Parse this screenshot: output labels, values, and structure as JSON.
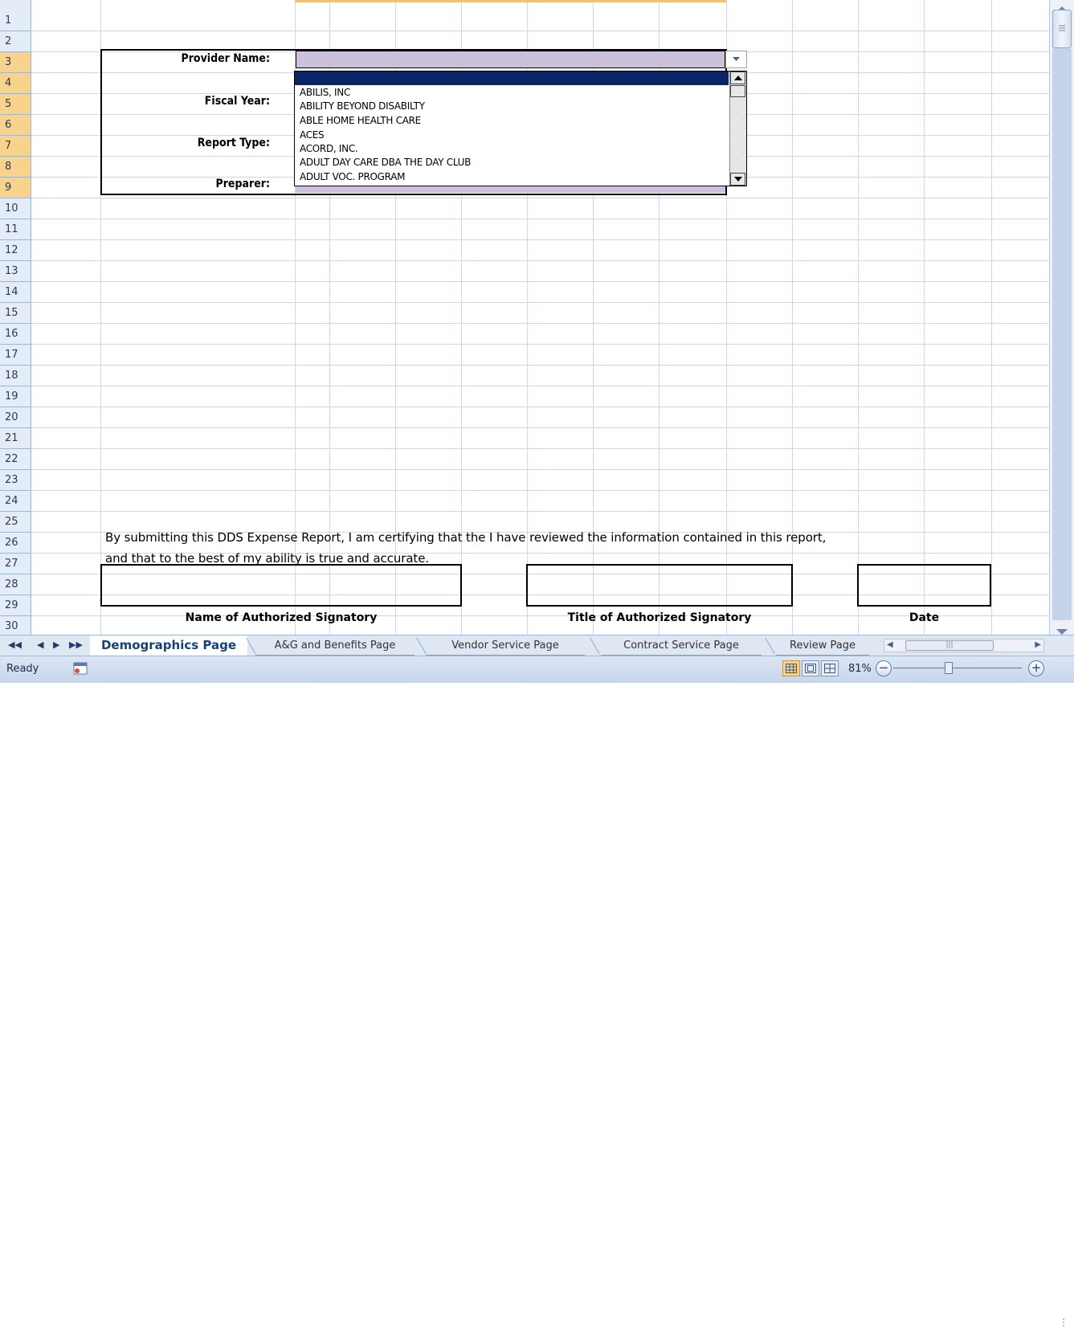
{
  "rows": [
    "1",
    "2",
    "3",
    "4",
    "5",
    "6",
    "7",
    "8",
    "9",
    "10",
    "11",
    "12",
    "13",
    "14",
    "15",
    "16",
    "17",
    "18",
    "19",
    "20",
    "21",
    "22",
    "23",
    "24",
    "25",
    "26",
    "27",
    "28",
    "29",
    "30"
  ],
  "form": {
    "provider_label": "Provider Name:",
    "fiscal_label": "Fiscal Year:",
    "report_type_label": "Report Type:",
    "preparer_label": "Preparer:"
  },
  "dropdown": {
    "items": [
      "ABILIS, INC",
      "ABILITY BEYOND DISABILTY",
      "ABLE HOME HEALTH CARE",
      "ACES",
      "ACORD, INC.",
      "ADULT DAY CARE DBA THE DAY CLUB",
      "ADULT VOC. PROGRAM"
    ]
  },
  "certification": {
    "line1": "By submitting this DDS Expense Report, I am certifying that the I have reviewed the information contained in this report,",
    "line2": "and that to the best of my ability is true and accurate."
  },
  "signatures": {
    "name_caption": "Name of Authorized Signatory",
    "title_caption": "Title of Authorized Signatory",
    "date_caption": "Date"
  },
  "tabs": [
    "Demographics Page",
    "A&G and Benefits Page",
    "Vendor Service Page",
    "Contract Service Page",
    "Review Page"
  ],
  "active_tab": "Demographics Page",
  "status": {
    "text": "Ready",
    "zoom": "81%"
  },
  "colors": {
    "field_fill": "#ccc0da",
    "selected_item": "#0a246a",
    "header_highlight": "#f5c074"
  }
}
